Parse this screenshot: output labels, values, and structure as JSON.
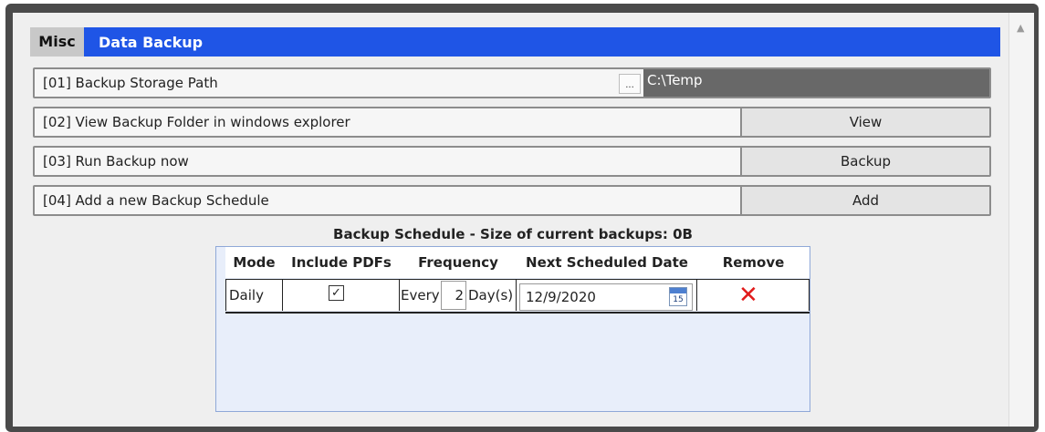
{
  "header": {
    "tab": "Misc",
    "title": "Data Backup"
  },
  "settings": [
    {
      "label": "[01] Backup Storage Path",
      "browse_label": "...",
      "value": "C:\\Temp"
    },
    {
      "label": "[02] View Backup Folder in windows explorer",
      "button": "View"
    },
    {
      "label": "[03] Run Backup now",
      "button": "Backup"
    },
    {
      "label": "[04] Add a new Backup Schedule",
      "button": "Add"
    }
  ],
  "schedule": {
    "title": "Backup Schedule - Size of current backups: 0B",
    "columns": [
      "Mode",
      "Include PDFs",
      "Frequency",
      "Next Scheduled Date",
      "Remove"
    ],
    "rows": [
      {
        "mode": "Daily",
        "include_pdfs": true,
        "check_glyph": "✓",
        "every_label": "Every",
        "interval": "2",
        "unit_label": "Day(s)",
        "next_date": "12/9/2020",
        "calendar_day": "15",
        "remove_glyph": "✕"
      }
    ]
  },
  "icons": {
    "scroll_up": "▲",
    "remove": "red-x-icon",
    "calendar": "calendar-icon"
  },
  "colors": {
    "accent": "#1f55e6",
    "remove": "#e11b1b"
  }
}
